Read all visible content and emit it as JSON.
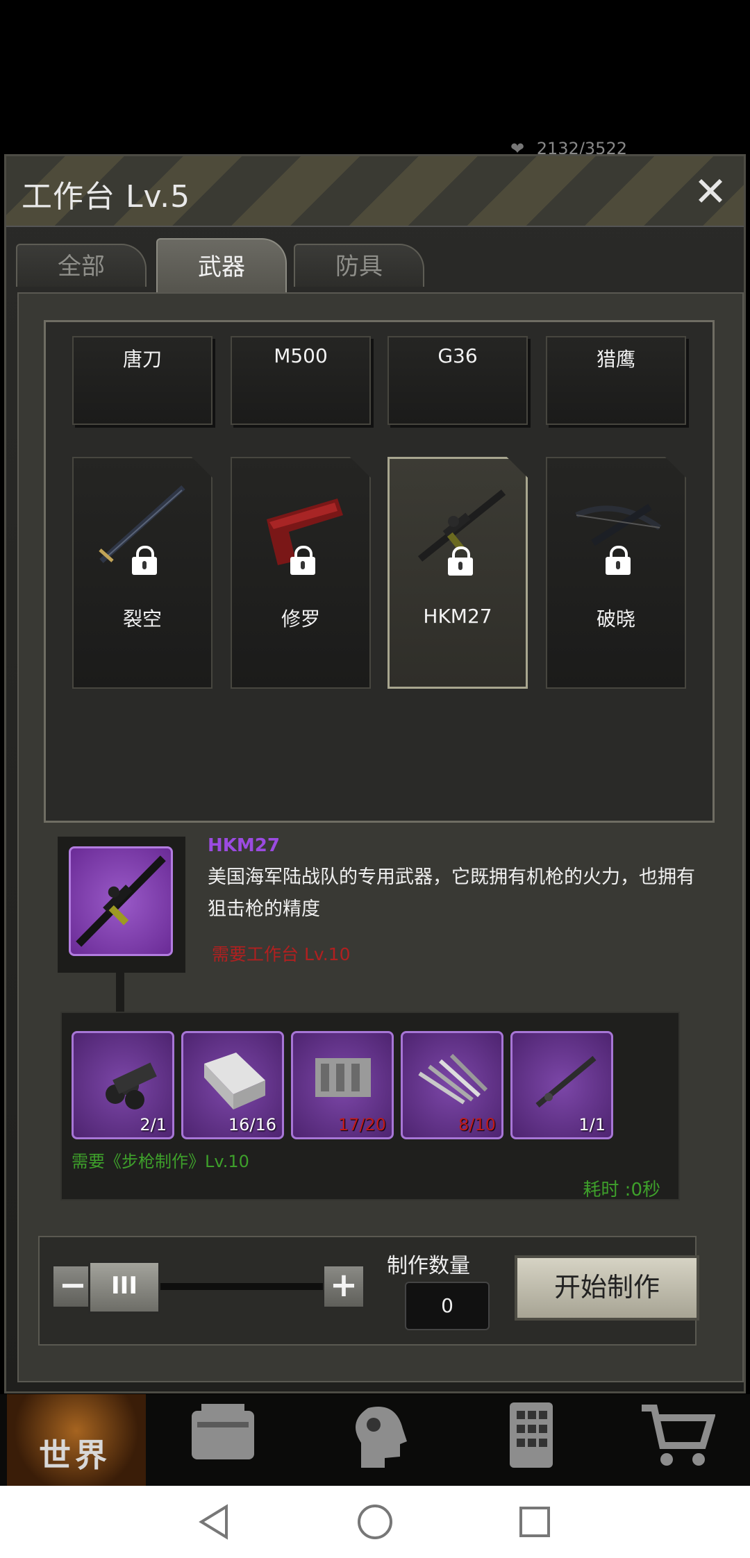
{
  "hud": {
    "life_value": "2132/3522",
    "life_label": "生命"
  },
  "workbench": {
    "title": "工作台 Lv.5",
    "close_label": "✕"
  },
  "tabs": [
    {
      "label": "全部",
      "active": false
    },
    {
      "label": "武器",
      "active": true
    },
    {
      "label": "防具",
      "active": false
    }
  ],
  "top_row_items": [
    "唐刀",
    "M500",
    "G36",
    "猎鹰"
  ],
  "locked_items": [
    {
      "name": "裂空",
      "icon": "sword-icon",
      "locked": true
    },
    {
      "name": "修罗",
      "icon": "pistol-icon",
      "locked": true
    },
    {
      "name": "HKM27",
      "icon": "rifle-icon",
      "locked": true,
      "selected": true
    },
    {
      "name": "破晓",
      "icon": "crossbow-icon",
      "locked": true
    }
  ],
  "detail": {
    "name": "HKM27",
    "description": "美国海军陆战队的专用武器，它既拥有机枪的火力，也拥有狙击枪的精度",
    "requirement_bench": "需要工作台 Lv.10"
  },
  "materials": [
    {
      "icon": "pipes-icon",
      "count": "2/1",
      "sufficient": true
    },
    {
      "icon": "metal-block-icon",
      "count": "16/16",
      "sufficient": true
    },
    {
      "icon": "machine-parts-icon",
      "count": "17/20",
      "sufficient": false
    },
    {
      "icon": "steel-rods-icon",
      "count": "8/10",
      "sufficient": false
    },
    {
      "icon": "rifle-barrel-icon",
      "count": "1/1",
      "sufficient": true
    }
  ],
  "requirement_skill": "需要《步枪制作》Lv.10",
  "craft_time": "耗时 :0秒",
  "controls": {
    "minus": "−",
    "plus": "+",
    "handle": "III",
    "qty_label": "制作数量",
    "qty_value": "0",
    "start_label": "开始制作"
  },
  "bottom_nav": {
    "world_label": "世界"
  },
  "colors": {
    "locked_red": "#c01a1a",
    "skill_green": "#3ea02b",
    "rarity_purple": "#7c47a8"
  }
}
